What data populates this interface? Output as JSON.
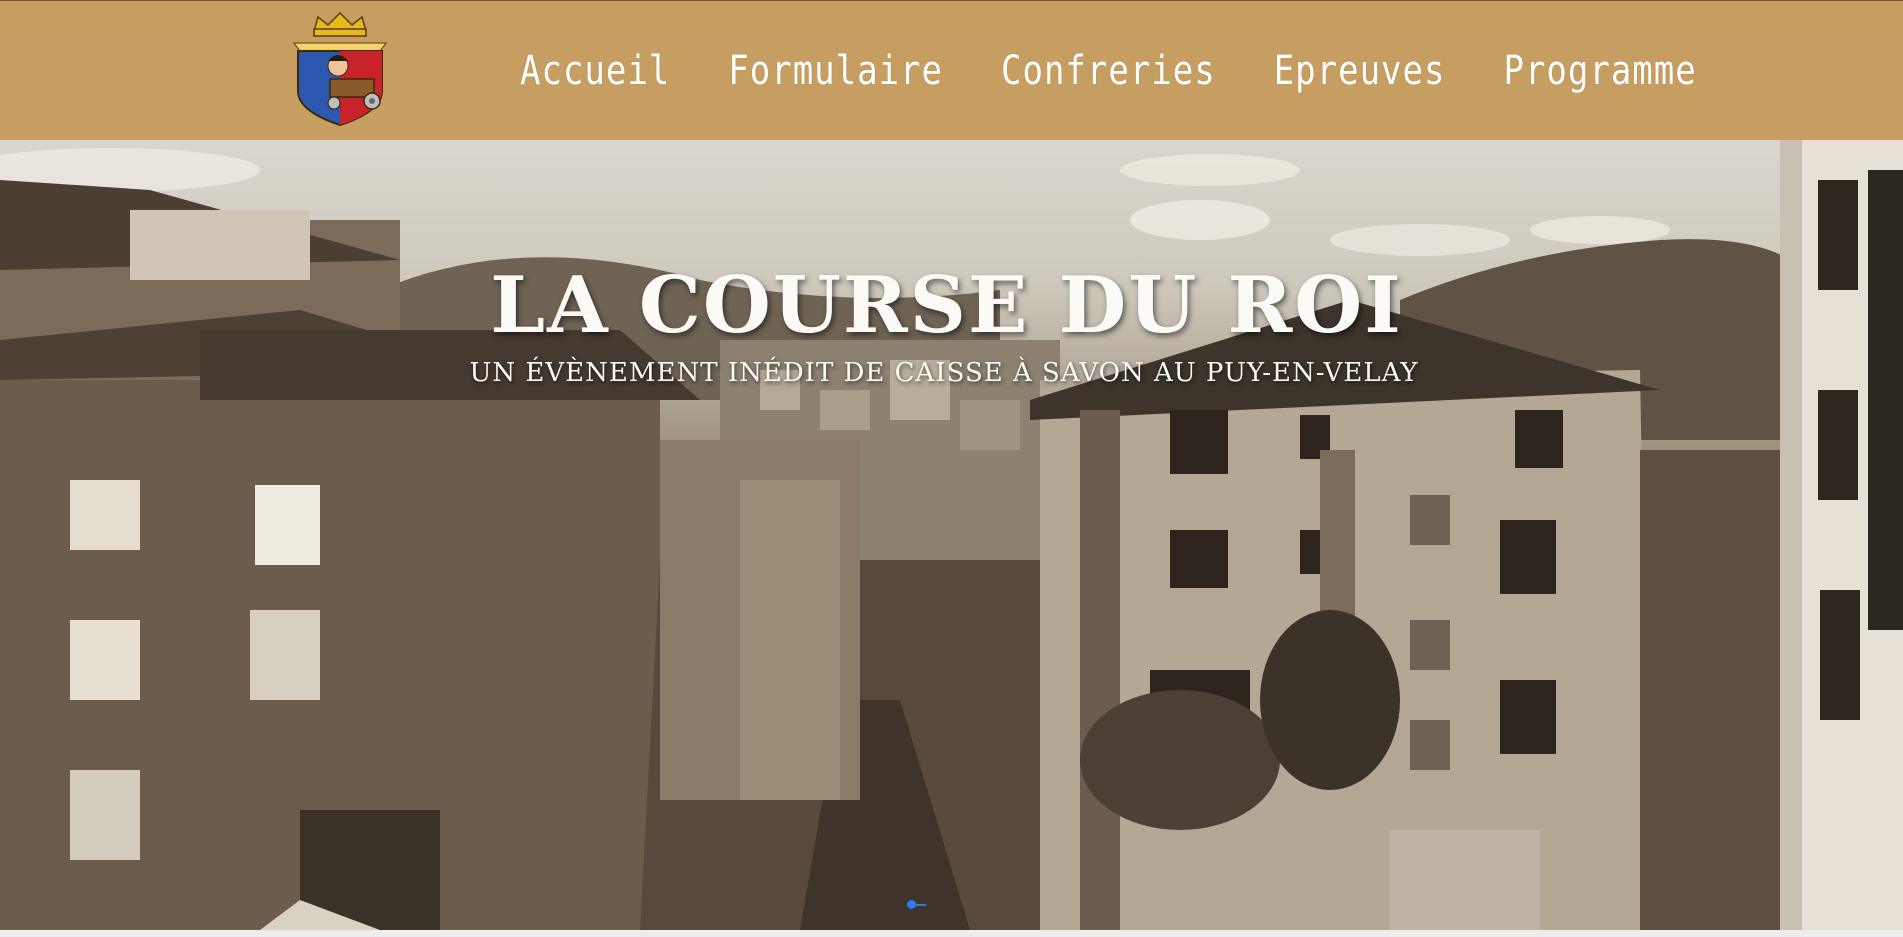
{
  "header": {
    "logo_name": "crowned-shield-logo",
    "nav": [
      {
        "label": "Accueil"
      },
      {
        "label": "Formulaire"
      },
      {
        "label": "Confreries"
      },
      {
        "label": "Epreuves"
      },
      {
        "label": "Programme"
      }
    ],
    "background_color": "#c79e61"
  },
  "hero": {
    "title": "LA COURSE DU ROI",
    "subtitle": "UN ÉVÈNEMENT INÉDIT DE CAISSE À SAVON AU PUY-EN-VELAY",
    "image_description_icon": "sepia-old-town-street-photo",
    "slider_indicator_color": "#2b7de9"
  }
}
